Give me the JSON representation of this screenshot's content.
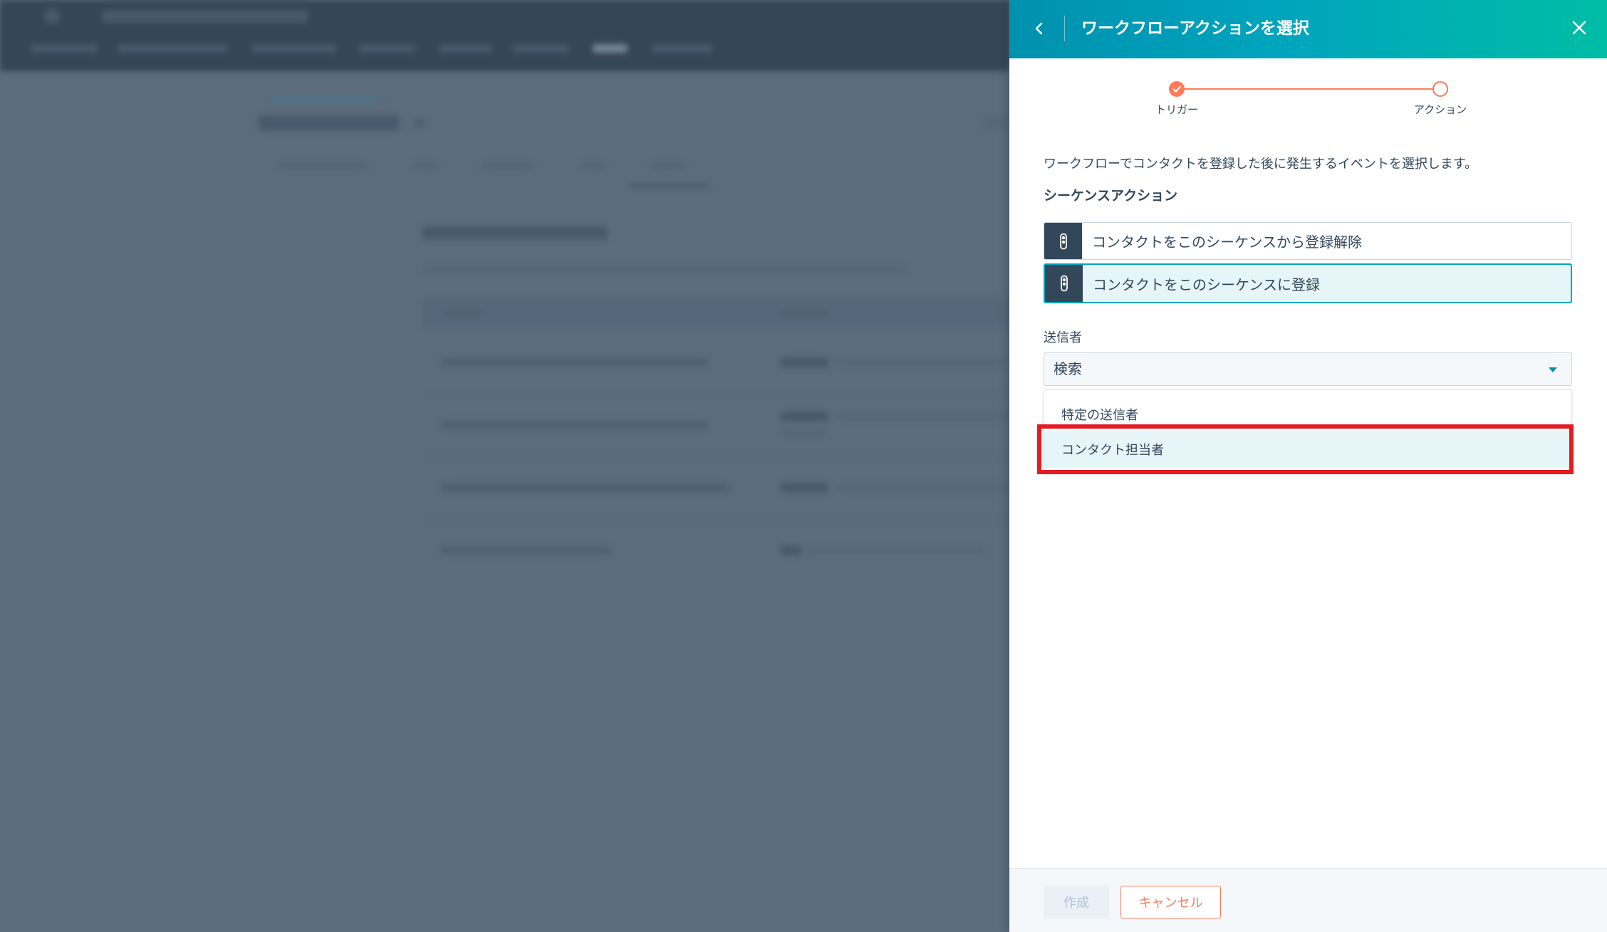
{
  "panel": {
    "title": "ワークフローアクションを選択",
    "back_icon": "chevron-left-icon",
    "close_icon": "close-icon"
  },
  "stepper": {
    "steps": [
      {
        "label": "トリガー",
        "status": "completed",
        "icon": "check-icon"
      },
      {
        "label": "アクション",
        "status": "current"
      }
    ]
  },
  "description": "ワークフローでコンタクトを登録した後に発生するイベントを選択します。",
  "section_heading": "シーケンスアクション",
  "actions": [
    {
      "label": "コンタクトをこのシーケンスから登録解除",
      "icon": "sequence-icon",
      "selected": false
    },
    {
      "label": "コンタクトをこのシーケンスに登録",
      "icon": "sequence-icon",
      "selected": true
    }
  ],
  "sender": {
    "label": "送信者",
    "value": "検索",
    "caret_icon": "caret-down-icon",
    "options": [
      "特定の送信者",
      "コンタクト担当者"
    ],
    "highlighted_option": 1
  },
  "footer": {
    "create_label": "作成",
    "create_disabled": true,
    "cancel_label": "キャンセル"
  },
  "colors": {
    "header_gradient_start": "#0091ae",
    "header_gradient_end": "#00bda5",
    "accent_orange": "#ff7a59",
    "selected_bg": "#e5f5f8",
    "selected_border": "#00a4bd",
    "text": "#33475b",
    "annotation_red": "#e31b23",
    "overlay": "#5c6c7d"
  }
}
